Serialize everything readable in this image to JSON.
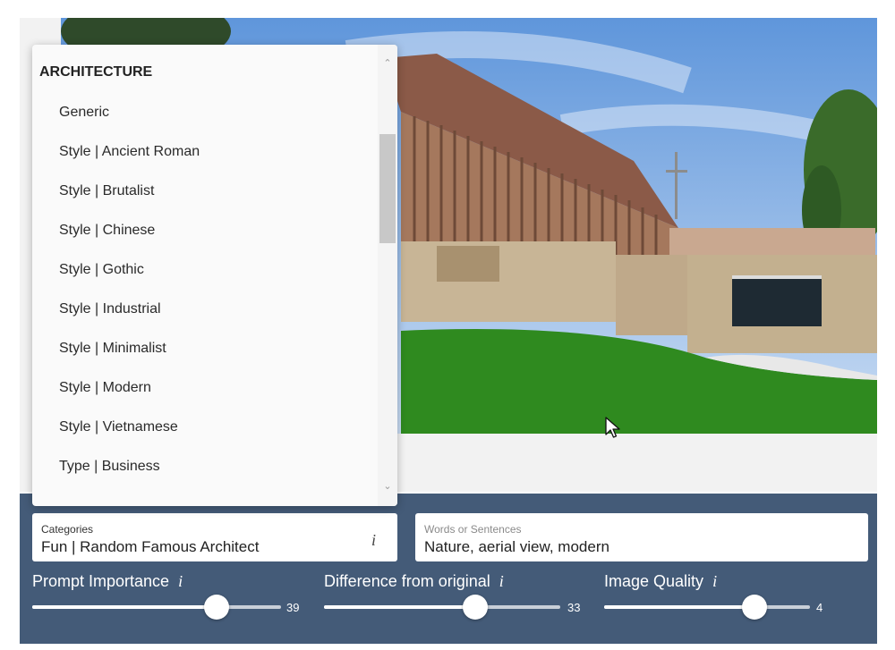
{
  "dropdown": {
    "header": "ARCHITECTURE",
    "options": [
      "Generic",
      "Style | Ancient Roman",
      "Style | Brutalist",
      "Style | Chinese",
      "Style | Gothic",
      "Style | Industrial",
      "Style | Minimalist",
      "Style | Modern",
      "Style | Vietnamese",
      "Type | Business"
    ]
  },
  "categories": {
    "label": "Categories",
    "value": "Fun | Random Famous Architect",
    "info": "i"
  },
  "words": {
    "label": "Words or Sentences",
    "value": "Nature, aerial view, modern"
  },
  "sliders": {
    "prompt_importance": {
      "label": "Prompt Importance",
      "info": "i",
      "value": "39",
      "fraction": 0.74
    },
    "difference": {
      "label": "Difference from original",
      "info": "i",
      "value": "33",
      "fraction": 0.64
    },
    "quality": {
      "label": "Image Quality",
      "info": "i",
      "value": "4",
      "fraction": 0.73
    }
  },
  "colors": {
    "panel": "#445b78",
    "sky": "#8fb6e3",
    "grass": "#2e8a1e"
  },
  "icons": {
    "info": "info-icon",
    "scroll_up": "chevron-up-icon",
    "scroll_down": "chevron-down-icon",
    "cursor": "mouse-pointer-icon"
  }
}
